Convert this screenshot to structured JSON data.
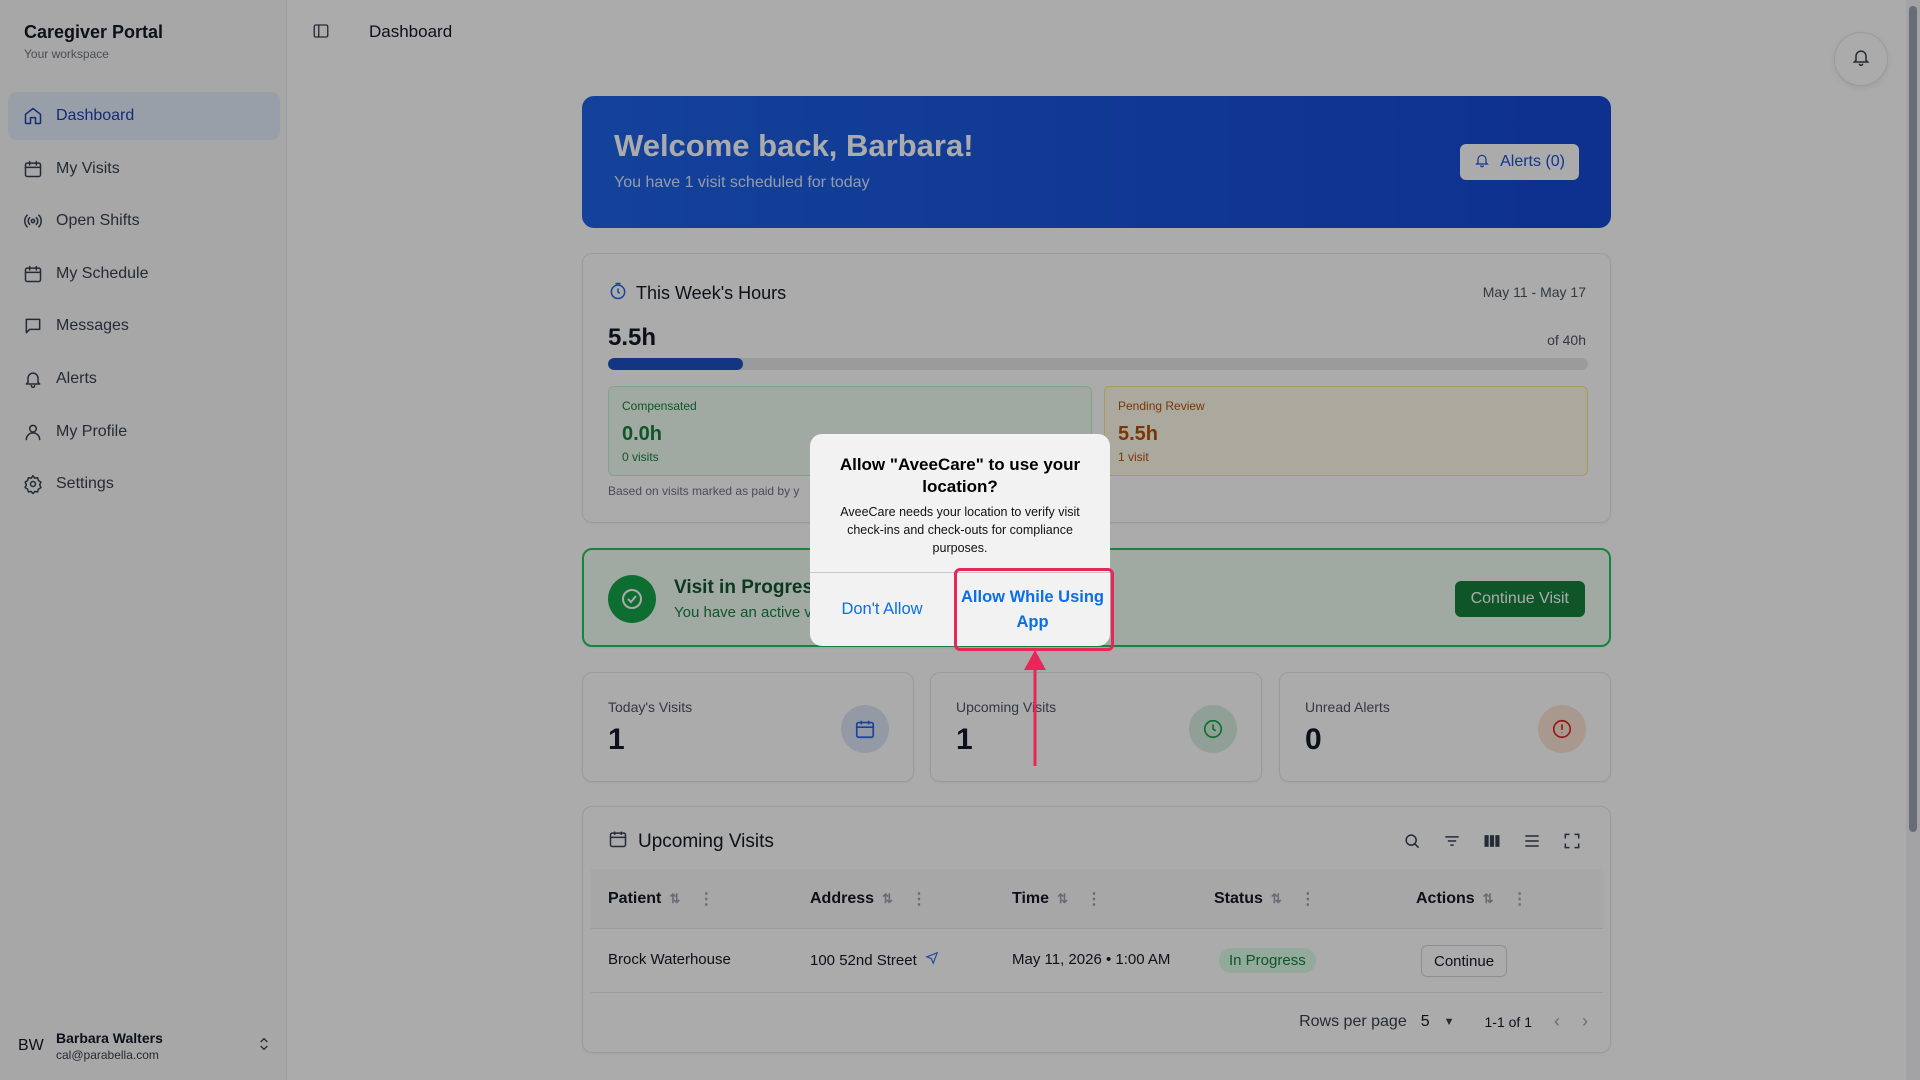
{
  "brand": {
    "title": "Caregiver Portal",
    "subtitle": "Your workspace"
  },
  "nav": [
    {
      "label": "Dashboard",
      "icon": "home-icon",
      "active": true
    },
    {
      "label": "My Visits",
      "icon": "calendar-icon"
    },
    {
      "label": "Open Shifts",
      "icon": "broadcast-icon"
    },
    {
      "label": "My Schedule",
      "icon": "calendar-icon"
    },
    {
      "label": "Messages",
      "icon": "message-icon"
    },
    {
      "label": "Alerts",
      "icon": "bell-icon"
    },
    {
      "label": "My Profile",
      "icon": "user-icon"
    },
    {
      "label": "Settings",
      "icon": "gear-icon"
    }
  ],
  "user": {
    "initials": "BW",
    "name": "Barbara Walters",
    "email": "cal@parabella.com"
  },
  "topbar": {
    "title": "Dashboard"
  },
  "welcome": {
    "title": "Welcome back, Barbara!",
    "subtitle": "You have 1 visit scheduled for today",
    "alerts_label": "Alerts (0)"
  },
  "hours": {
    "title": "This Week's Hours",
    "range": "May 11 - May 17",
    "value": "5.5h",
    "of": "of 40h",
    "progress_fraction": 0.1375,
    "compensated": {
      "label": "Compensated",
      "value": "0.0h",
      "foot": "0 visits"
    },
    "pending": {
      "label": "Pending Review",
      "value": "5.5h",
      "foot": "1 visit"
    },
    "based": "Based on visits marked as paid by y"
  },
  "visit_in_progress": {
    "title": "Visit in Progress",
    "subtitle": "You have an active vi",
    "button": "Continue Visit"
  },
  "stats": [
    {
      "label": "Today's Visits",
      "value": "1",
      "icon": "calendar-icon"
    },
    {
      "label": "Upcoming Visits",
      "value": "1",
      "icon": "clock-icon"
    },
    {
      "label": "Unread Alerts",
      "value": "0",
      "icon": "alert-circle-icon"
    }
  ],
  "upcoming": {
    "title": "Upcoming Visits",
    "columns": [
      "Patient",
      "Address",
      "Time",
      "Status",
      "Actions"
    ],
    "rows": [
      {
        "patient": "Brock Waterhouse",
        "address": "100 52nd Street",
        "time": "May 11, 2026 • 1:00 AM",
        "status": "In Progress",
        "action": "Continue"
      }
    ],
    "rows_per_page_label": "Rows per page",
    "rows_per_page": "5",
    "range": "1-1 of 1"
  },
  "dialog": {
    "title": "Allow \"AveeCare\" to use your location?",
    "message": "AveeCare needs your location to verify visit check-ins and check-outs for compliance purposes.",
    "deny": "Don't Allow",
    "allow": "Allow While Using App"
  },
  "colors": {
    "accent": "#1e62e6",
    "success": "#16a34a",
    "highlight": "#e8265a",
    "ios_blue": "#0a6ee8"
  }
}
